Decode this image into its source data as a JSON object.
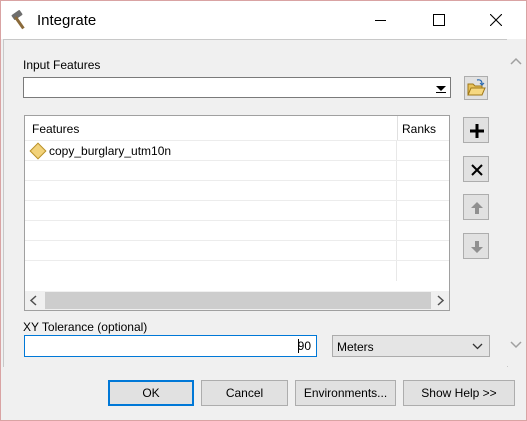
{
  "window": {
    "title": "Integrate"
  },
  "input_features": {
    "label": "Input Features",
    "value": ""
  },
  "feature_list": {
    "columns": [
      "Features",
      "Ranks"
    ],
    "rows": [
      {
        "feature": "copy_burglary_utm10n",
        "rank": ""
      }
    ]
  },
  "xy_tolerance": {
    "label": "XY Tolerance (optional)",
    "value": "90",
    "units": "Meters"
  },
  "buttons": {
    "ok": "OK",
    "cancel": "Cancel",
    "environments": "Environments...",
    "show_help": "Show Help >>"
  },
  "colors": {
    "accent": "#0078d7",
    "feature_icon": "#f2d27a"
  }
}
